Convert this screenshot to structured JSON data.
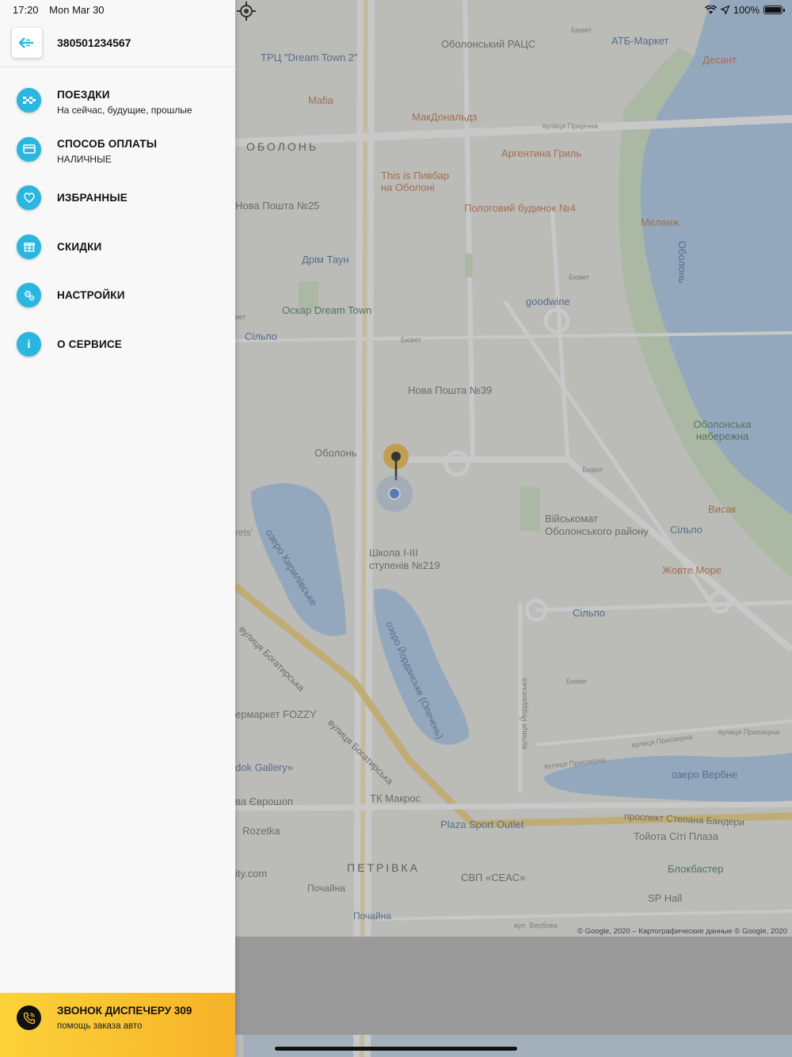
{
  "status": {
    "time": "17:20",
    "date": "Mon Mar 30",
    "battery": "100%"
  },
  "drawer": {
    "phone": "380501234567",
    "accent": "#29b7e0",
    "menu": [
      {
        "title": "ПОЕЗДКИ",
        "subtitle": "На сейчас, будущие, прошлые",
        "icon": "taxi-checker-icon"
      },
      {
        "title": "СПОСОБ ОПЛАТЫ",
        "subtitle": "НАЛИЧНЫЕ",
        "icon": "credit-card-icon"
      },
      {
        "title": "ИЗБРАННЫЕ",
        "subtitle": "",
        "icon": "heart-icon"
      },
      {
        "title": "СКИДКИ",
        "subtitle": "",
        "icon": "gift-icon"
      },
      {
        "title": "НАСТРОЙКИ",
        "subtitle": "",
        "icon": "settings-icon"
      },
      {
        "title": "О СЕРВИСЕ",
        "subtitle": "",
        "icon": "info-icon",
        "glyph": "i"
      }
    ],
    "call": {
      "title": "ЗВОНОК ДИСПЕЧЕРУ 309",
      "subtitle": "помощь заказа авто"
    }
  },
  "map": {
    "labels": {
      "trc_dream": "ТРЦ \"Dream Town 2\"",
      "obolon_racs": "Оболонський РАЦС",
      "atb": "АТБ-Маркет",
      "desant": "Десант",
      "byuvet1": "Бювет",
      "mafia": "Mafia",
      "mcdonalds": "МакДональдз",
      "prirechna": "вулиця Прирічна",
      "obolon_district": "ОБОЛОНЬ",
      "argentina": "Аргентина Гриль",
      "pyvbar": "This is Пивбар на Оболоні",
      "nova25": "Нова Пошта №25",
      "pologovyi": "Пологовий будинок №4",
      "melanzh": "Меланж",
      "obolon_water": "Оболонь",
      "drim_taun": "Дрім Таун",
      "byuvet2": "Бювет",
      "goodwine": "goodwine",
      "oskar": "Оскар Dream Town",
      "silpo1": "Сільпо",
      "byuvet3": "Бювет",
      "nova39": "Нова Пошта №39",
      "naberezhna": "Оболонська набережна",
      "obolon_metro": "Оболонь",
      "byuvet4": "Бювет",
      "viyskomat": "Військомат Оболонського району",
      "vysak": "Висак",
      "silpo2": "Сільпо",
      "ozero_kyryl": "озеро Кирилівське",
      "shkola": "Школа І-ІІІ ступенів №219",
      "zhovte": "Жовте Море",
      "silpo3": "Сільпо",
      "bogatyrska1": "вулиця Богатирська",
      "ozero_yord": "озеро Йорданське (Опечень)",
      "byuvet5": "Бювет",
      "yordanska": "вулиця Йорданська",
      "fozzy": "ермаркет FOZZY",
      "bogatyrska2": "вулиця Богатирська",
      "priozerna1": "вулиця Приозерна",
      "priozerna2": "вулиця Приозерна",
      "priozerna3": "вулиця Приозерна",
      "dok_gallery": "dok Gallery»",
      "ozero_verbne": "озеро Вербне",
      "evroshop": "ва Єврошоп",
      "makros": "ТК Макрос",
      "bandery": "проспект Степана Бандери",
      "rozetka": "Rozetka",
      "plaza": "Plaza Sport Outlet",
      "toyota": "Тойота Сіті Плаза",
      "petrivka": "ПЕТРІВКА",
      "city_com": "ity.com",
      "sveas": "СВП «СЕАС»",
      "blokbaster": "Блокбастер",
      "pochaina1": "Почайна",
      "sphall": "SP Hall",
      "pochaina2": "Почайна",
      "verbova": "вул. Вербова",
      "rets": "rets'",
      "byuvet_left": "вет"
    },
    "copyright": "© Google, 2020 – Картографические данные © Google, 2020"
  }
}
